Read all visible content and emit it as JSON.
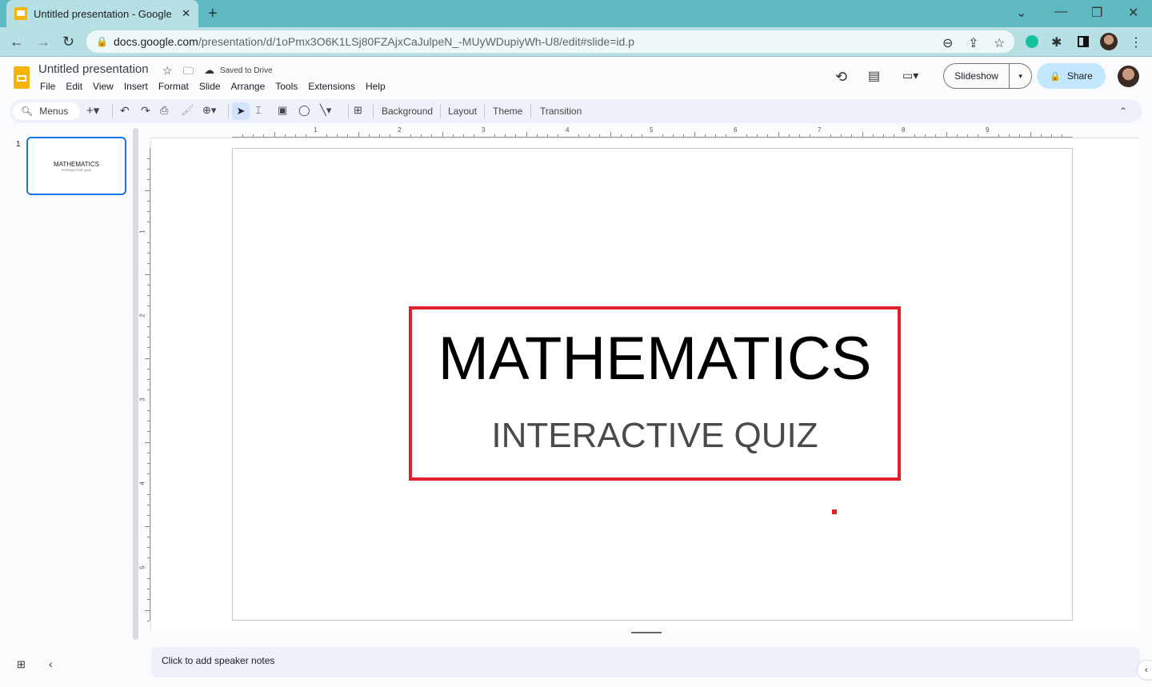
{
  "browser": {
    "tab_title": "Untitled presentation - Google Sl",
    "url_host": "docs.google.com",
    "url_path": "/presentation/d/1oPmx3O6K1LSj80FZAjxCaJulpeN_-MUyWDupiyWh-U8/edit#slide=id.p"
  },
  "app": {
    "doc_title": "Untitled presentation",
    "save_status": "Saved to Drive",
    "menus": [
      "File",
      "Edit",
      "View",
      "Insert",
      "Format",
      "Slide",
      "Arrange",
      "Tools",
      "Extensions",
      "Help"
    ],
    "slideshow_label": "Slideshow",
    "share_label": "Share",
    "accent": "#1a73e8"
  },
  "toolbar": {
    "search_label": "Menus",
    "background": "Background",
    "layout": "Layout",
    "theme": "Theme",
    "transition": "Transition"
  },
  "ruler": {
    "horizontal": [
      "1",
      "2",
      "3",
      "4",
      "5",
      "6",
      "7",
      "8",
      "9"
    ],
    "vertical": [
      "1",
      "2",
      "3",
      "4",
      "5"
    ]
  },
  "filmstrip": {
    "slide_number": "1",
    "thumb_title": "MATHEMATICS",
    "thumb_subtitle": "INTERACTIVE QUIZ"
  },
  "slide": {
    "title": "MATHEMATICS",
    "subtitle": "INTERACTIVE QUIZ",
    "box_color": "#e0202a"
  },
  "notes": {
    "placeholder": "Click to add speaker notes"
  }
}
